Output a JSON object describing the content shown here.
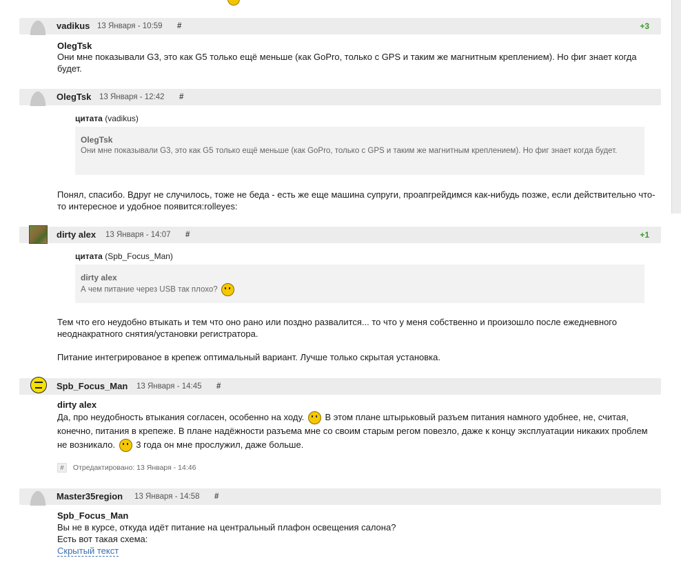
{
  "posts": [
    {
      "username": "vadikus",
      "date": "13 Января - 10:59",
      "hash": "#",
      "rating": "+3",
      "addressee": "OlegTsk",
      "text": "Они мне показывали G3, это как G5 только ещё меньше (как GoPro, только с GPS и таким же магнитным креплением). Но фиг знает когда будет."
    },
    {
      "username": "OlegTsk",
      "date": "13 Января - 12:42",
      "hash": "#",
      "quote_label": "цитата",
      "quote_source": "(vadikus)",
      "quote_name": "OlegTsk",
      "quote_text": "Они мне показывали G3, это как G5 только ещё меньше (как GoPro, только с GPS и таким же магнитным креплением). Но фиг знает когда будет.",
      "text": "Понял, спасибо. Вдруг не случилось, тоже не беда - есть же еще машина супруги, проапгрейдимся как-нибудь позже, если действительно что-то интересное и удобное появится:rolleyes:"
    },
    {
      "username": "dirty alex",
      "date": "13 Января - 14:07",
      "hash": "#",
      "rating": "+1",
      "quote_label": "цитата",
      "quote_source": "(Spb_Focus_Man)",
      "quote_name": "dirty alex",
      "quote_text": "А чем питание через USB так плохо?",
      "text1": "Тем что его неудобно втыкать и тем что оно рано или поздно развалится... то что у меня собственно и произошло после ежедневного неоднакратного снятия/установки регистратора.",
      "text2": "Питание интегрированое в крепеж оптимальный вариант. Лучше только скрытая установка."
    },
    {
      "username": "Spb_Focus_Man",
      "date": "13 Января - 14:45",
      "hash": "#",
      "addressee": "dirty alex",
      "text_a": "Да, про неудобность втыкания согласен, особенно на ходу.",
      "text_b": "В этом плане штырьковый разъем питания намного удобнее, не, считая, конечно, питания в крепеже. В плане надёжности разъема мне со своим старым регом повезло, даже к концу эксплуатации никаких проблем не возникало.",
      "text_c": "3 года он мне прослужил, даже больше.",
      "edited_hash": "#",
      "edited": "Отредактировано: 13 Января - 14:46"
    },
    {
      "username": "Master35region",
      "date": "13 Января - 14:58",
      "hash": "#",
      "addressee": "Spb_Focus_Man",
      "line1": "Вы не в курсе, откуда идёт питание на центральный плафон освещения салона?",
      "line2": "Есть вот такая схема:",
      "hidden_text": "Скрытый текст"
    }
  ]
}
